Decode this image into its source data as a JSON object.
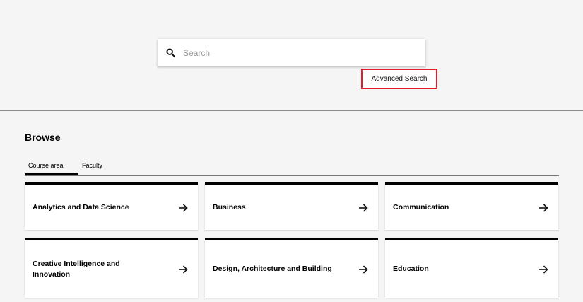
{
  "search": {
    "placeholder": "Search",
    "advanced_label": "Advanced Search"
  },
  "browse": {
    "title": "Browse",
    "tabs": [
      {
        "label": "Course area",
        "active": true
      },
      {
        "label": "Faculty",
        "active": false
      }
    ],
    "cards": [
      {
        "label": "Analytics and Data Science"
      },
      {
        "label": "Business"
      },
      {
        "label": "Communication"
      },
      {
        "label": "Creative Intelligence and Innovation"
      },
      {
        "label": "Design, Architecture and Building"
      },
      {
        "label": "Education"
      }
    ]
  },
  "colors": {
    "highlight_border": "#e11d2a",
    "background": "#f5f5f5"
  }
}
